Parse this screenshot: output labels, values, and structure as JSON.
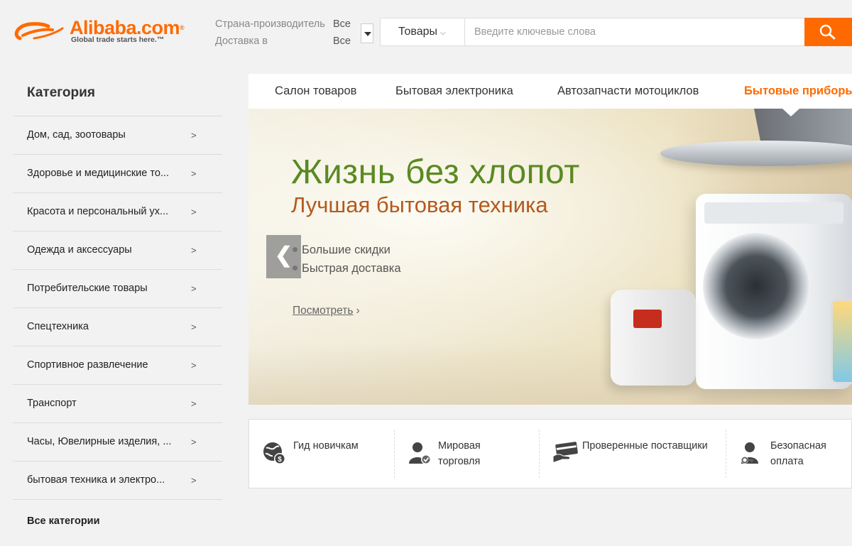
{
  "header": {
    "logo_text": "Alibaba.com",
    "logo_tm": "®",
    "tagline": "Global trade starts here.™",
    "filters": [
      {
        "label": "Страна-производитель",
        "value": "Все"
      },
      {
        "label": "Доставка в",
        "value": "Все"
      }
    ],
    "search": {
      "category": "Товары",
      "placeholder": "Введите ключевые слова"
    }
  },
  "sidebar": {
    "title": "Категория",
    "items": [
      {
        "label": "Дом, сад, зоотовары",
        "arrow": ">"
      },
      {
        "label": "Здоровье и медицинские то...",
        "arrow": ">"
      },
      {
        "label": "Красота и персональный ух...",
        "arrow": ">"
      },
      {
        "label": "Одежда и аксессуары",
        "arrow": ">"
      },
      {
        "label": "Потребительские товары",
        "arrow": ">"
      },
      {
        "label": "Спецтехника",
        "arrow": ">"
      },
      {
        "label": "Спортивное развлечение",
        "arrow": ">"
      },
      {
        "label": "Транспорт",
        "arrow": ">"
      },
      {
        "label": "Часы, Ювелирные изделия, ...",
        "arrow": ">"
      },
      {
        "label": "бытовая техника и электро...",
        "arrow": ">"
      }
    ],
    "all_categories": "Все категории"
  },
  "tabs": [
    {
      "label": "Салон товаров",
      "active": false
    },
    {
      "label": "Бытовая электроника",
      "active": false
    },
    {
      "label": "Автозапчасти мотоциклов",
      "active": false
    },
    {
      "label": "Бытовые приборы",
      "active": true
    }
  ],
  "banner": {
    "title": "Жизнь без хлопот",
    "subtitle": "Лучшая бытовая техника",
    "bullets": [
      "Большие скидки",
      "Быстрая доставка"
    ],
    "link": "Посмотреть",
    "link_arrow": "›",
    "prev_arrow": "❮"
  },
  "services": [
    {
      "label_1": "Гид новичкам",
      "label_2": "",
      "icon": "globe-dollar-icon"
    },
    {
      "label_1": "Мировая",
      "label_2": "торговля",
      "icon": "verified-user-icon"
    },
    {
      "label_1": "Проверенные поставщики",
      "label_2": "",
      "icon": "card-hand-icon"
    },
    {
      "label_1": "Безопасная",
      "label_2": "оплата",
      "icon": "user-key-icon"
    }
  ],
  "colors": {
    "accent": "#ff6a00",
    "banner_title": "#5a8a22",
    "banner_subtitle": "#b35a1e"
  }
}
